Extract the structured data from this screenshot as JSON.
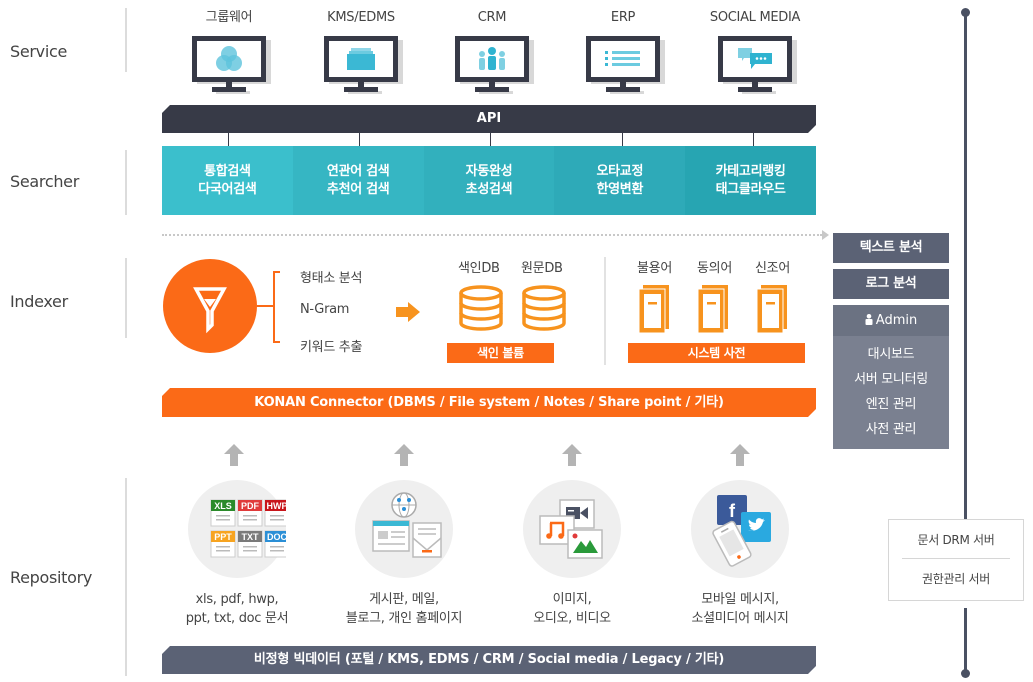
{
  "layers": [
    {
      "label": "Service"
    },
    {
      "label": "Searcher"
    },
    {
      "label": "Indexer"
    },
    {
      "label": "Repository"
    }
  ],
  "services": [
    {
      "title": "그룹웨어",
      "icon": "groupware-venn-icon"
    },
    {
      "title": "KMS/EDMS",
      "icon": "document-stack-icon"
    },
    {
      "title": "CRM",
      "icon": "people-group-icon"
    },
    {
      "title": "ERP",
      "icon": "list-icon"
    },
    {
      "title": "SOCIAL MEDIA",
      "icon": "chat-bubbles-icon"
    }
  ],
  "api": {
    "label": "API"
  },
  "searcher": {
    "cells": [
      {
        "line1": "통합검색",
        "line2": "다국어검색",
        "color": "#3bbfcc"
      },
      {
        "line1": "연관어 검색",
        "line2": "추천어 검색",
        "color": "#36b6c3"
      },
      {
        "line1": "자동완성",
        "line2": "초성검색",
        "color": "#32b0bd"
      },
      {
        "line1": "오타교정",
        "line2": "한영변환",
        "color": "#2eaab8"
      },
      {
        "line1": "카테고리랭킹",
        "line2": "태그클라우드",
        "color": "#27a5b2"
      }
    ]
  },
  "indexer": {
    "funnel_icon": "funnel-icon",
    "analysis_items": [
      "형태소 분석",
      "N-Gram",
      "키워드 추출"
    ],
    "db_labels": [
      "색인DB",
      "원문DB"
    ],
    "db_tag": "색인 볼륨",
    "dict_labels": [
      "불용어",
      "동의어",
      "신조어"
    ],
    "dict_tag": "시스템 사전"
  },
  "connector": {
    "label": "KONAN Connector (DBMS / File system / Notes / Share point / 기타)"
  },
  "repository": {
    "items": [
      {
        "line1": "xls, pdf, hwp,",
        "line2": "ppt, txt, doc 문서",
        "icon": "document-files-icon",
        "file_types": [
          {
            "label": "XLS",
            "color": "#2a8a2a"
          },
          {
            "label": "PDF",
            "color": "#e03a3a"
          },
          {
            "label": "HWP",
            "color": "#c8151b"
          },
          {
            "label": "PPT",
            "color": "#f7a421"
          },
          {
            "label": "TXT",
            "color": "#7a7a7a"
          },
          {
            "label": "DOC",
            "color": "#2b8fd6"
          }
        ]
      },
      {
        "line1": "게시판, 메일,",
        "line2": "블로그, 개인 홈페이지",
        "icon": "web-mail-icon"
      },
      {
        "line1": "이미지,",
        "line2": "오디오, 비디오",
        "icon": "media-icon"
      },
      {
        "line1": "모바일 메시지,",
        "line2": "소셜미디어 메시지",
        "icon": "social-mobile-icon"
      }
    ]
  },
  "bigdata": {
    "label": "비정형 빅데이터 (포털 / KMS, EDMS / CRM / Social media / Legacy / 기타)"
  },
  "right_panel": {
    "text_analysis": "텍스트 분석",
    "log_analysis": "로그 분석",
    "admin": {
      "title": "Admin",
      "items": [
        "대시보드",
        "서버 모니터링",
        "엔진 관리",
        "사전 관리"
      ]
    }
  },
  "drm": {
    "items": [
      "문서 DRM 서버",
      "권한관리 서버"
    ]
  },
  "colors": {
    "orange": "#fb6a17",
    "dark_navy": "#373a47",
    "slate": "#5b6275",
    "teal": "#3bbfcc"
  }
}
